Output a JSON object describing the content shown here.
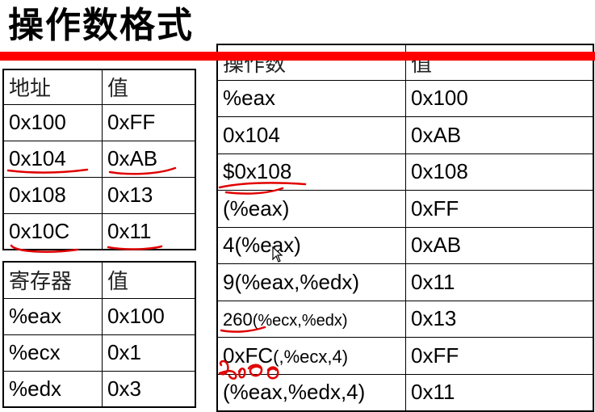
{
  "title": "操作数格式",
  "memory_table": {
    "headers": [
      "地址",
      "值"
    ],
    "rows": [
      [
        "0x100",
        "0xFF"
      ],
      [
        "0x104",
        "0xAB"
      ],
      [
        "0x108",
        "0x13"
      ],
      [
        "0x10C",
        "0x11"
      ]
    ]
  },
  "register_table": {
    "headers": [
      "寄存器",
      "值"
    ],
    "rows": [
      [
        "%eax",
        "0x100"
      ],
      [
        "%ecx",
        "0x1"
      ],
      [
        "%edx",
        "0x3"
      ]
    ]
  },
  "operand_table": {
    "headers": [
      "操作数",
      "值"
    ],
    "rows": [
      [
        "%eax",
        "0x100"
      ],
      [
        "0x104",
        "0xAB"
      ],
      [
        "$0x108",
        "0x108"
      ],
      [
        "(%eax)",
        "0xFF"
      ],
      [
        "4(%eax)",
        "0xAB"
      ],
      [
        "9(%eax,%edx)",
        "0x11"
      ],
      [
        "260",
        "(%ecx,%edx)",
        "0x13"
      ],
      [
        "0xFC",
        "(,%ecx,4)",
        "0xFF"
      ],
      [
        "(%eax,%edx,4)",
        "0x11"
      ]
    ]
  },
  "colors": {
    "accent_bar": "#ff0000",
    "annotation_ink": "#e00000"
  }
}
